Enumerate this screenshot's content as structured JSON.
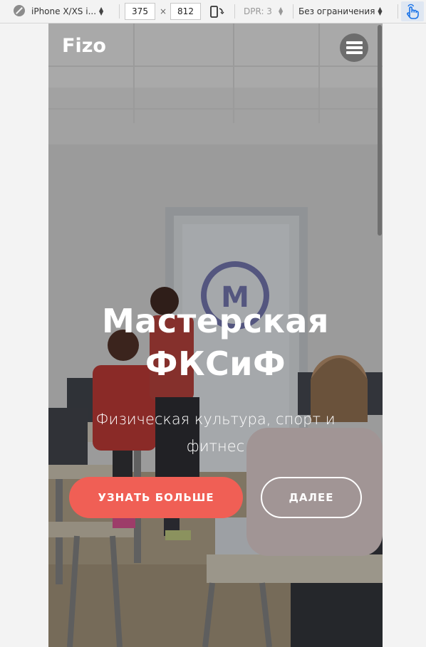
{
  "devtools": {
    "device": "iPhone X/XS i...",
    "width": "375",
    "times": "×",
    "height": "812",
    "dpr": "DPR: 3",
    "throttling": "Без ограничения"
  },
  "site": {
    "brand": "Fizo",
    "hero": {
      "title_line1": "Мастерская",
      "title_line2": "ФКСиФ",
      "subtitle_line1": "Физическая культура, спорт и",
      "subtitle_line2": "фитнес",
      "primary_button": "УЗНАТЬ БОЛЬШЕ",
      "secondary_button": "ДАЛЕЕ"
    }
  },
  "colors": {
    "accent": "#f05f55",
    "toolbar_bg": "#f3f3f3",
    "touch_active": "#1a73e8"
  }
}
